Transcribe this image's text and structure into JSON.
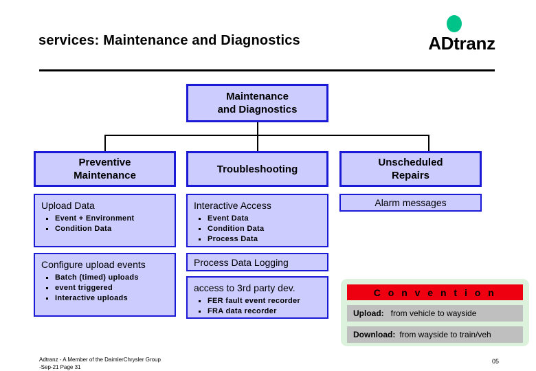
{
  "header": {
    "title": "services: Maintenance and Diagnostics",
    "logo_text": "ADtranz",
    "logo_dot_color": "#00c389"
  },
  "colors": {
    "box_fill": "#ccccff",
    "box_border": "#1a1ad6",
    "legend_bg": "#ddf2dd",
    "legend_header_bg": "#ee0011",
    "legend_row_bg": "#bfbfbf"
  },
  "diagram": {
    "root": {
      "line1": "Maintenance",
      "line2": "and Diagnostics"
    },
    "columns": [
      {
        "heading_line1": "Preventive",
        "heading_line2": "Maintenance",
        "blocks": [
          {
            "title": "Upload Data",
            "items": [
              "Event + Environment",
              "Condition Data"
            ]
          },
          {
            "title": "Configure upload events",
            "items": [
              "Batch (timed) uploads",
              "event triggered",
              "Interactive uploads"
            ]
          }
        ]
      },
      {
        "heading_line1": "Troubleshooting",
        "heading_line2": "",
        "blocks": [
          {
            "title": "Interactive Access",
            "items": [
              "Event Data",
              "Condition Data",
              "Process Data"
            ]
          },
          {
            "title": "Process Data Logging",
            "items": []
          },
          {
            "title": "access to 3rd party dev.",
            "items": [
              "FER fault event recorder",
              "FRA data recorder"
            ]
          }
        ]
      },
      {
        "heading_line1": "Unscheduled",
        "heading_line2": "Repairs",
        "blocks": [
          {
            "title": "Alarm messages",
            "items": []
          }
        ]
      }
    ]
  },
  "legend": {
    "title": "C o n v e n t i o n",
    "rows": [
      {
        "key": "Upload:",
        "value": "from vehicle to wayside"
      },
      {
        "key": "Download:",
        "value": "from wayside to train/veh"
      }
    ]
  },
  "footer": {
    "line1": "Adtranz - A Member of the DaimlerChrysler Group",
    "line2": "-Sep-21   Page 31",
    "page": "05"
  }
}
